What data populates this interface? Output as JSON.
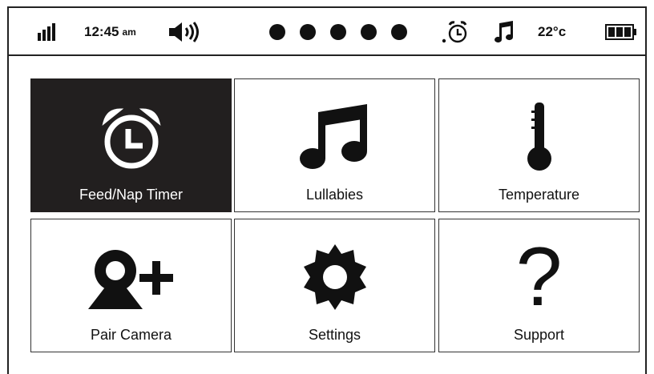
{
  "status": {
    "time": "12:45",
    "ampm": "am",
    "temperature": "22°c",
    "signal_icon": "signal-bars-icon",
    "volume_icon": "speaker-icon",
    "alarm_icon": "alarm-clock-icon",
    "music_icon": "music-note-icon",
    "battery_icon": "battery-full-icon",
    "page_dots": 5
  },
  "menu": {
    "tiles": [
      {
        "label": "Feed/Nap Timer",
        "icon": "alarm-clock-icon",
        "active": true
      },
      {
        "label": "Lullabies",
        "icon": "music-notes-icon",
        "active": false
      },
      {
        "label": "Temperature",
        "icon": "thermometer-icon",
        "active": false
      },
      {
        "label": "Pair Camera",
        "icon": "camera-add-icon",
        "active": false
      },
      {
        "label": "Settings",
        "icon": "gear-icon",
        "active": false
      },
      {
        "label": "Support",
        "icon": "question-mark-icon",
        "active": false
      }
    ]
  },
  "colors": {
    "active_tile": "#221f1f",
    "foreground": "#111111",
    "background": "#ffffff"
  }
}
